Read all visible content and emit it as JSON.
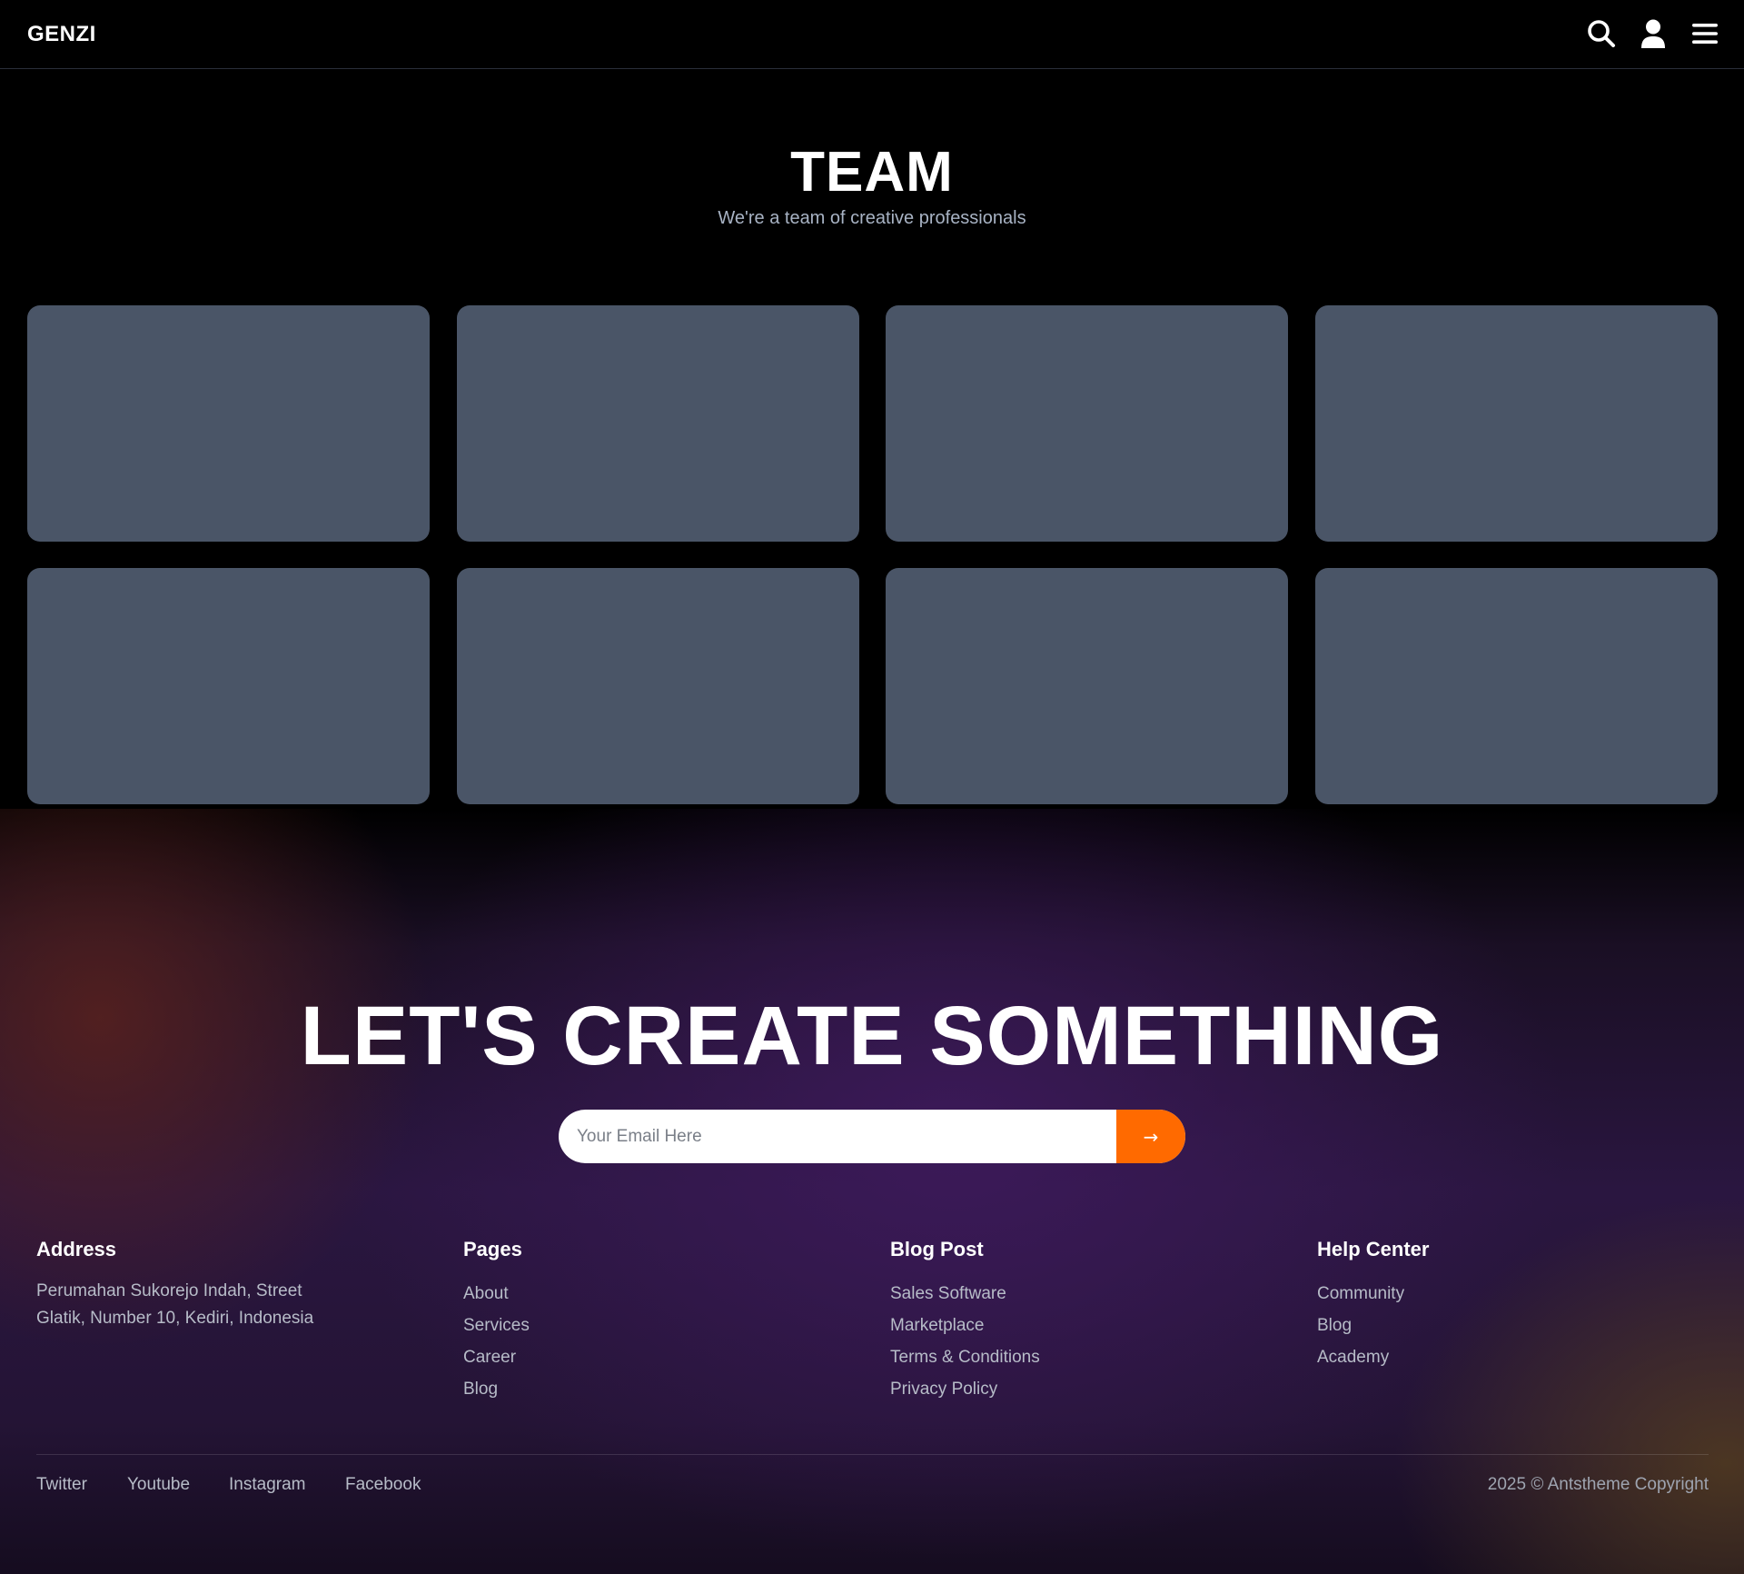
{
  "navbar": {
    "brand": "GENZI",
    "icons": [
      "search-icon",
      "user-icon",
      "menu-icon"
    ]
  },
  "team": {
    "title": "TEAM",
    "subtitle": "We're a team of creative professionals",
    "card_count": 8,
    "card_color": "#4a5567"
  },
  "cta": {
    "title": "LET'S CREATE SOMETHING",
    "email_placeholder": "Your Email Here",
    "submit_label": "→",
    "accent_color": "#ff6a00"
  },
  "footer": {
    "address": {
      "heading": "Address",
      "line1": "Perumahan Sukorejo Indah, Street",
      "line2": "Glatik, Number 10, Kediri, Indonesia"
    },
    "pages": {
      "heading": "Pages",
      "links": [
        "About",
        "Services",
        "Career",
        "Blog"
      ]
    },
    "blog_post": {
      "heading": "Blog Post",
      "links": [
        "Sales Software",
        "Marketplace",
        "Terms & Conditions",
        "Privacy Policy"
      ]
    },
    "help_center": {
      "heading": "Help Center",
      "links": [
        "Community",
        "Blog",
        "Academy"
      ]
    },
    "social": [
      "Twitter",
      "Youtube",
      "Instagram",
      "Facebook"
    ],
    "copyright": "2025 © Antstheme Copyright"
  }
}
